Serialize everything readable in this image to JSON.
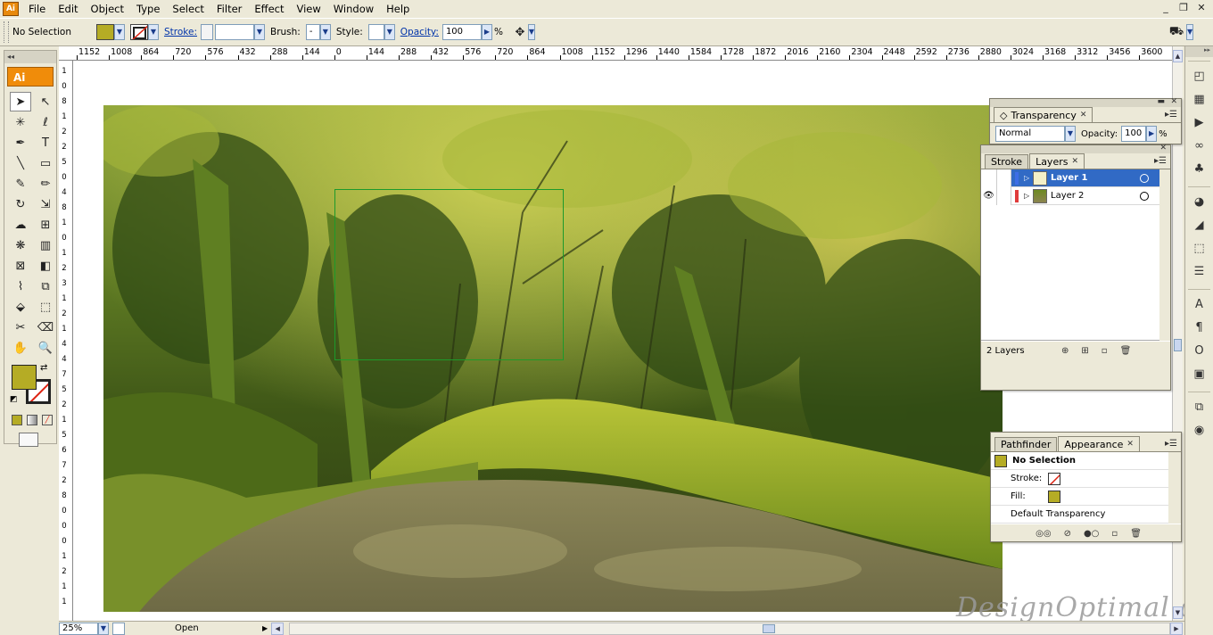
{
  "app": {
    "badge": "Ai",
    "logo": "Ai"
  },
  "menu": [
    "File",
    "Edit",
    "Object",
    "Type",
    "Select",
    "Filter",
    "Effect",
    "View",
    "Window",
    "Help"
  ],
  "window_controls": {
    "minimize": "_",
    "restore": "❐",
    "close": "✕"
  },
  "control_bar": {
    "selection_status": "No Selection",
    "fill_color": "#b5ac25",
    "stroke_label": "Stroke:",
    "brush_label": "Brush:",
    "brush_value": "-",
    "style_label": "Style:",
    "opacity_label": "Opacity:",
    "opacity_value": "100",
    "opacity_unit": "%"
  },
  "ruler": {
    "horizontal": [
      "1152",
      "1008",
      "864",
      "720",
      "576",
      "432",
      "288",
      "144",
      "0",
      "144",
      "288",
      "432",
      "576",
      "720",
      "864",
      "1008",
      "1152",
      "1296",
      "1440",
      "1584",
      "1728",
      "1872",
      "2016",
      "2160",
      "2304",
      "2448",
      "2592",
      "2736",
      "2880",
      "3024",
      "3168",
      "3312",
      "3456",
      "3600"
    ],
    "vertical": [
      "1",
      "0",
      "8",
      "1",
      "2",
      "2",
      "5",
      "0",
      "4",
      "8",
      "1",
      "0",
      "1",
      "2",
      "3",
      "1",
      "2",
      "1",
      "4",
      "4",
      "7",
      "5",
      "2",
      "1",
      "5",
      "6",
      "7",
      "2",
      "8",
      "0",
      "0",
      "0",
      "1",
      "2",
      "1",
      "1"
    ]
  },
  "transparency_panel": {
    "tab": "Transparency",
    "blend_mode": "Normal",
    "opacity_label": "Opacity:",
    "opacity_value": "100",
    "opacity_unit": "%"
  },
  "layers_panel": {
    "tabs": [
      "Stroke",
      "Layers"
    ],
    "layers": [
      {
        "name": "Layer 1",
        "color": "#3c6ee6",
        "selected": true
      },
      {
        "name": "Layer 2",
        "color": "#e03c3c",
        "selected": false
      }
    ],
    "count": "2 Layers"
  },
  "appearance_panel": {
    "tabs": [
      "Pathfinder",
      "Appearance"
    ],
    "title": "No Selection",
    "stroke_label": "Stroke:",
    "fill_label": "Fill:",
    "transparency_label": "Default Transparency"
  },
  "status_bar": {
    "zoom": "25%",
    "status": "Open"
  },
  "watermark": "DesignOptimal.com",
  "colors": {
    "fill": "#b5ac25",
    "selection": "#1d9a2b",
    "layer_highlight": "#316ac5",
    "accent": "#f08c0a"
  }
}
